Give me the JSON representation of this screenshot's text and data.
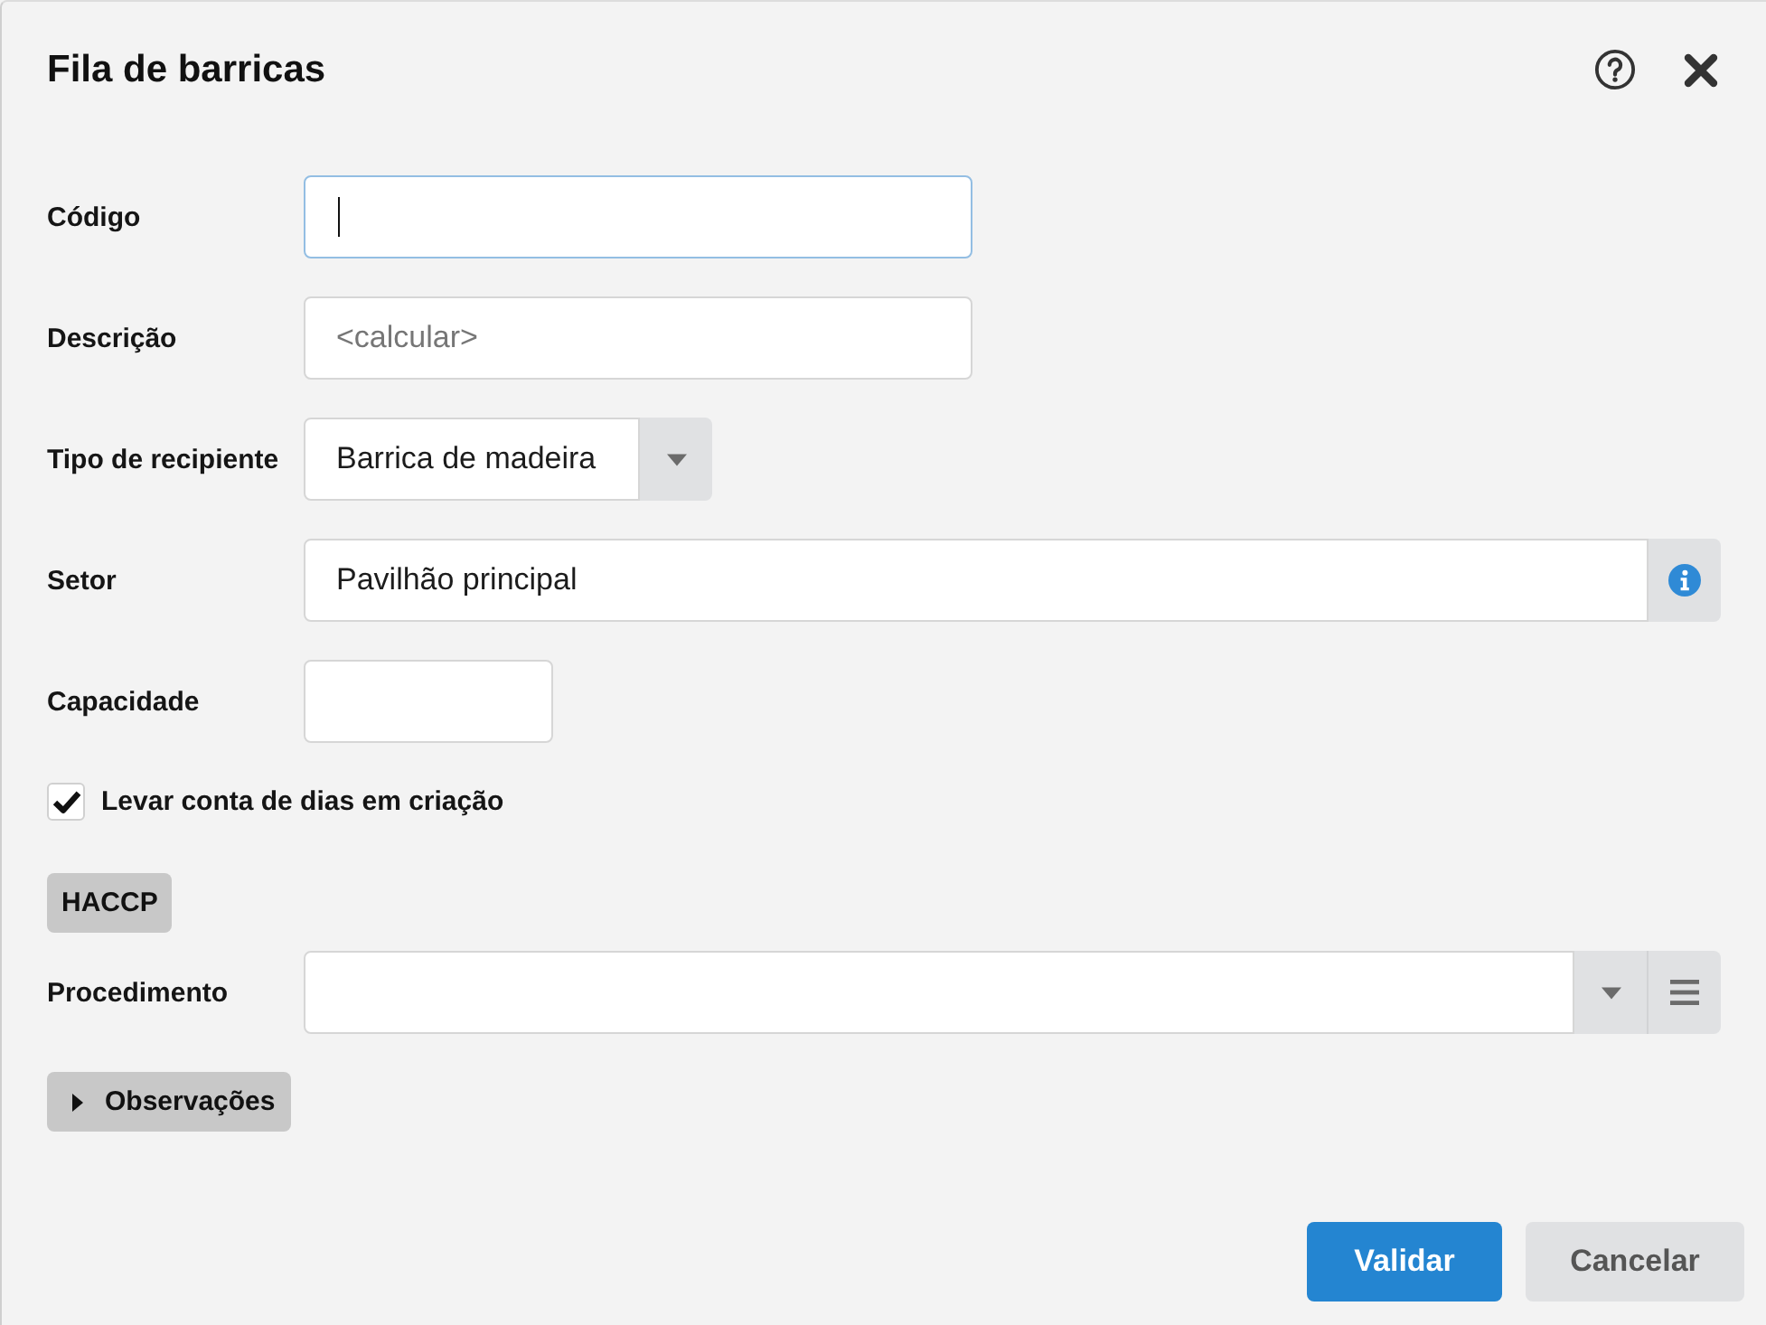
{
  "dialog": {
    "title": "Fila de barricas"
  },
  "fields": [
    {
      "kind": "text",
      "label": "Código",
      "focused": true
    },
    {
      "kind": "text",
      "label": "Descrição",
      "placeholder": "<calcular>",
      "focused": false
    },
    {
      "kind": "select",
      "label": "Tipo de recipiente",
      "value": "Barrica de madeira",
      "focused": false
    },
    {
      "kind": "lookup",
      "label": "Setor",
      "value": "Pavilhão principal",
      "focused": false
    },
    {
      "kind": "number",
      "label": "Capacidade",
      "focused": false
    },
    {
      "kind": "checkbox",
      "label": "Levar conta de dias em criação",
      "checked": true
    },
    {
      "kind": "section",
      "label": "HACCP"
    },
    {
      "kind": "combo",
      "label": "Procedimento",
      "focused": false
    },
    {
      "kind": "expander",
      "label": "Observações",
      "expanded": false
    }
  ],
  "buttons": [
    {
      "kind": "primary",
      "label": "Validar"
    },
    {
      "kind": "secondary",
      "label": "Cancelar"
    }
  ]
}
